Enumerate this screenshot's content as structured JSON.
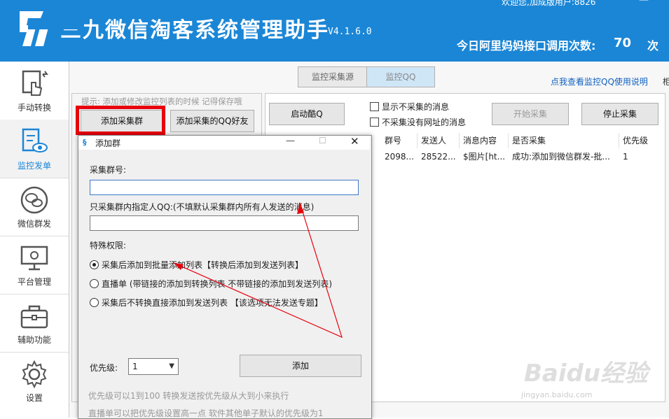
{
  "header": {
    "title": "三九微信淘客系统管理助手",
    "version": "V4.1.6.0",
    "welcome": "欢迎您,加成版用户:8826",
    "api_label": "今日阿里妈妈接口调用次数:",
    "api_count": "70",
    "api_unit": "次",
    "colors": {
      "bar": "#1b86d6",
      "text": "#ffffff"
    }
  },
  "sidebar": {
    "items": [
      {
        "label": "手动转换",
        "icon": "hand-pointer-icon"
      },
      {
        "label": "监控发单",
        "icon": "monitor-eye-icon"
      },
      {
        "label": "微信群发",
        "icon": "wechat-icon"
      },
      {
        "label": "平台管理",
        "icon": "settings-screen-icon"
      },
      {
        "label": "辅助功能",
        "icon": "toolbox-icon"
      },
      {
        "label": "设置",
        "icon": "gear-icon"
      }
    ],
    "active_index": 1
  },
  "tabs": {
    "source": "监控采集源",
    "qq": "监控QQ"
  },
  "help_link": "点我查看监控QQ使用说明",
  "help_link_tail": "柜",
  "left_panel": {
    "hint": "提示: 添加或修改监控列表的时候 记得保存哦",
    "add_group_label": "添加采集群",
    "add_qq_label": "添加采集的QQ好友"
  },
  "right_panel": {
    "start_q_label": "启动酷Q",
    "show_uncollected_label": "显示不采集的消息",
    "no_url_label": "不采集没有网址的消息",
    "start_collect_label": "开始采集",
    "stop_collect_label": "停止采集",
    "columns": [
      "群号",
      "发送人",
      "消息内容",
      "是否采集",
      "优先级"
    ],
    "rows": [
      [
        "2098...",
        "28522...",
        "$图片[ht...",
        "成功:添加到微信群发-批...",
        "1"
      ]
    ]
  },
  "dialog": {
    "title": "添加群",
    "group_label": "采集群号:",
    "group_value": "",
    "qq_label": "只采集群内指定人QQ:(不填默认采集群内所有人发送的消息)",
    "qq_value": "",
    "special_label": "特殊权限:",
    "radio_1": "采集后添加到批量添加列表【转换后添加到发送列表】",
    "radio_2": "直播单 (带链接的添加到转换列表 不带链接的添加到发送列表)",
    "radio_3": "采集后不转换直接添加到发送列表 【该选项无法发送专题】",
    "radio_selected": 1,
    "priority_label": "优先级:",
    "priority_value": "1",
    "add_label": "添加",
    "note_1": "优先级可以1到100 转换发送按优先级从大到小来执行",
    "note_2": "直播单可以把优先级设置高一点 软件其他单子默认的优先级为1"
  },
  "watermark": {
    "main": "Baidu经验",
    "sub": "jingyan.baidu.com"
  },
  "annotation_color": "#e8000c"
}
